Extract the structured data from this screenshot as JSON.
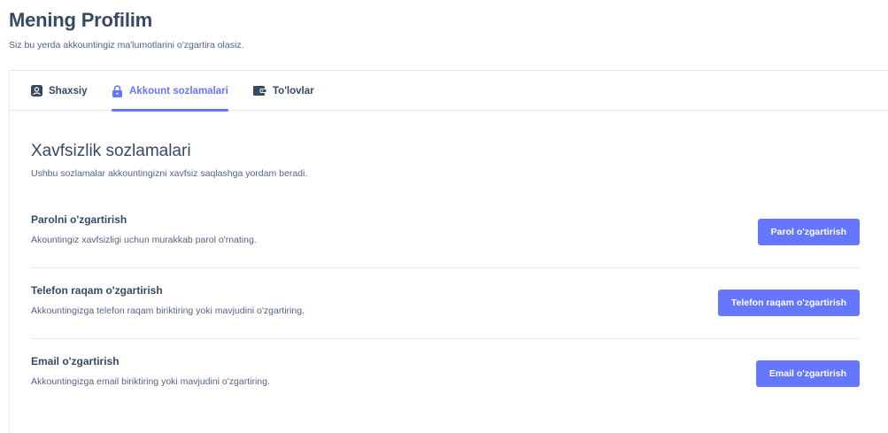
{
  "header": {
    "title": "Mening Profilim",
    "subtitle": "Siz bu yerda akkountingiz ma'lumotlarini o'zgartira olasiz."
  },
  "tabs": [
    {
      "label": "Shaxsiy",
      "icon": "user-icon",
      "active": false
    },
    {
      "label": "Akkount sozlamalari",
      "icon": "lock-icon",
      "active": true
    },
    {
      "label": "To'lovlar",
      "icon": "wallet-icon",
      "active": false
    }
  ],
  "section": {
    "title": "Xavfsizlik sozlamalari",
    "description": "Ushbu sozlamalar akkountingizni xavfsiz saqlashga yordam beradi."
  },
  "settings": [
    {
      "title": "Parolni o'zgartirish",
      "description": "Akountingiz xavfsizligi uchun murakkab parol o'rnating.",
      "button": "Parol o'zgartirish"
    },
    {
      "title": "Telefon raqam o'zgartirish",
      "description": "Akkountingizga telefon raqam biriktiring yoki mavjudini o'zgartiring.",
      "button": "Telefon raqam o'zgartirish"
    },
    {
      "title": "Email o'zgartirish",
      "description": "Akkountingizga email biriktiring yoki mavjudini o'zgartiring.",
      "button": "Email o'zgartirish"
    }
  ],
  "colors": {
    "accent": "#6576ff",
    "heading": "#364a63",
    "text": "#526484",
    "border": "#e5e9f2"
  }
}
